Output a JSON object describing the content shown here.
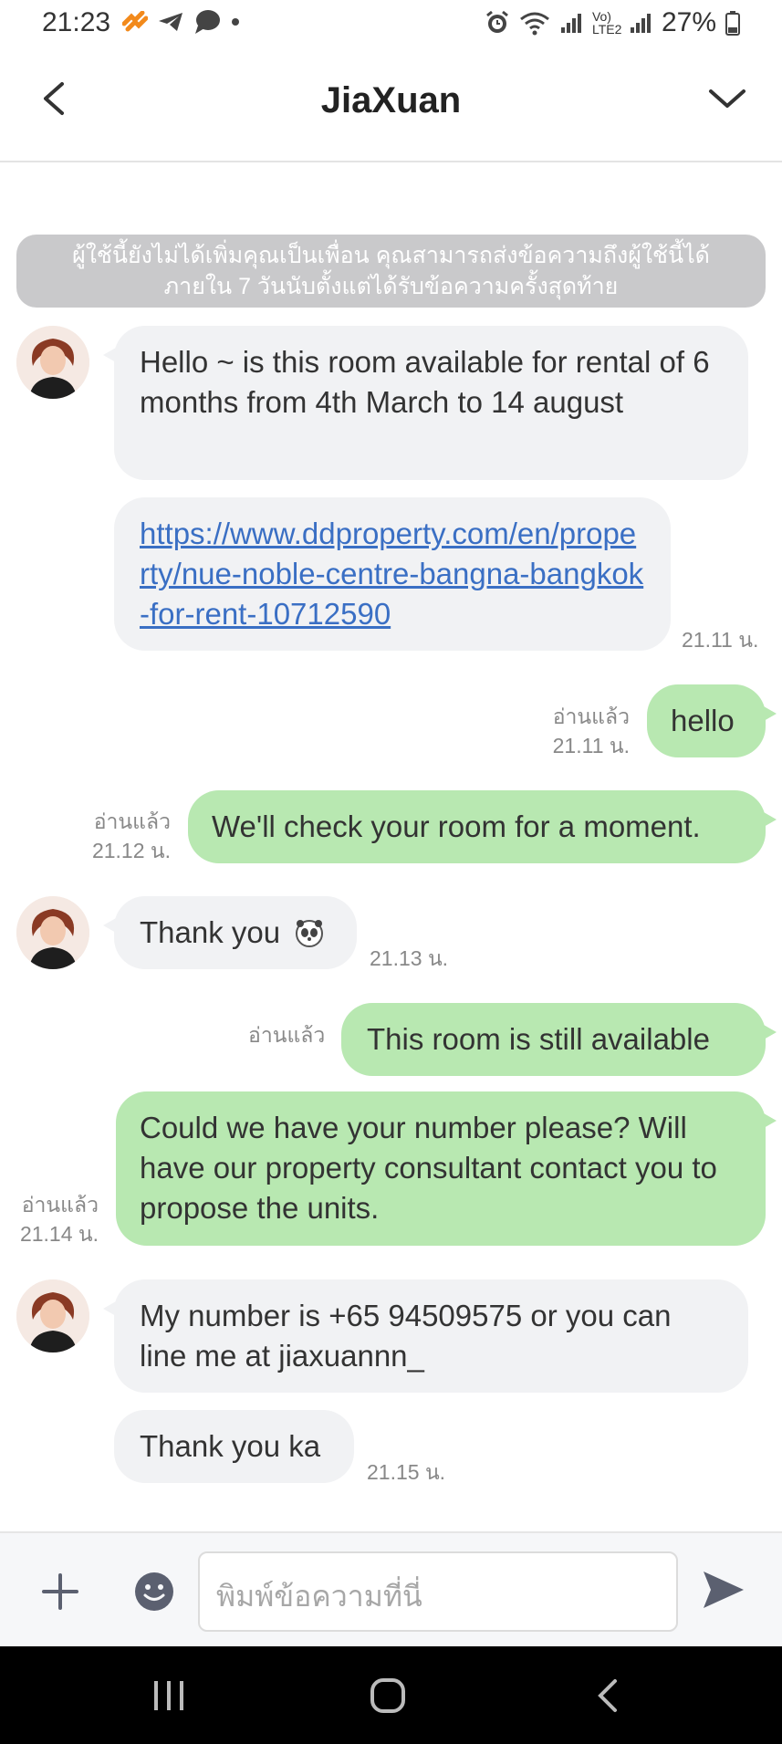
{
  "status_bar": {
    "time": "21:23",
    "battery": "27%",
    "network_label": "Vo) LTE2"
  },
  "header": {
    "title": "JiaXuan"
  },
  "notice": {
    "line1": "ผู้ใช้นี้ยังไม่ได้เพิ่มคุณเป็นเพื่อน คุณสามารถส่งข้อความถึงผู้ใช้นี้ได้",
    "line2": "ภายใน 7 วันนับตั้งแต่ได้รับข้อความครั้งสุดท้าย"
  },
  "messages": [
    {
      "text": "Hello ~ is this room available for rental of 6 months from 4th March to 14 august"
    },
    {
      "text": "https://www.ddproperty.com/en/property/nue-noble-centre-bangna-bangkok-for-rent-10712590",
      "time": "21.11 น."
    },
    {
      "text": "hello",
      "read": "อ่านแล้ว",
      "time": "21.11 น."
    },
    {
      "text": "We'll check your room for a moment.",
      "read": "อ่านแล้ว",
      "time": "21.12 น."
    },
    {
      "text": "Thank you",
      "time": "21.13 น."
    },
    {
      "text": "This room is still available",
      "read": "อ่านแล้ว"
    },
    {
      "text": "Could we have your number please? Will have our property consultant contact you to propose the units.",
      "read": "อ่านแล้ว",
      "time": "21.14 น."
    },
    {
      "text": "My number is +65 94509575 or you can line me at jiaxuannn_"
    },
    {
      "text": "Thank you ka",
      "time": "21.15 น."
    }
  ],
  "composer": {
    "placeholder": "พิมพ์ข้อความที่นี่"
  },
  "colors": {
    "outgoing": "#b8e8b1",
    "incoming": "#f1f2f4",
    "notice": "#c9c9cb",
    "link": "#3a6fc4"
  }
}
